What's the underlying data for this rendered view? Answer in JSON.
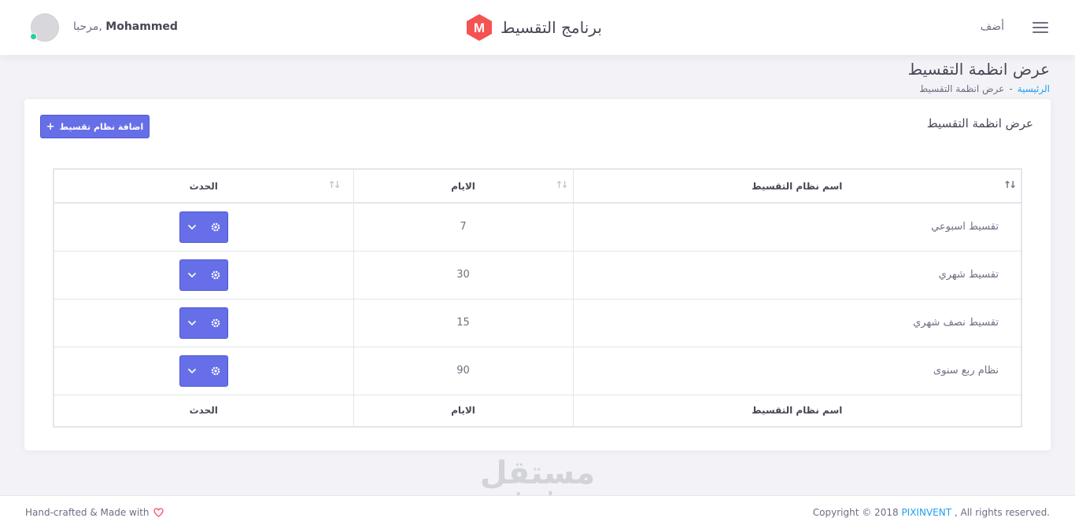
{
  "navbar": {
    "add_label": "أضف",
    "brand_letter": "M",
    "brand_name": "برنامج التقسيط",
    "greeting": "مرحبا,",
    "user_name": "Mohammed",
    "brand_color": "#f55252",
    "status_color": "#28d094"
  },
  "page": {
    "title": "عرض انظمة التقسيط",
    "breadcrumb_home": "الرئيسية",
    "breadcrumb_separator": "-",
    "breadcrumb_current": "عرض انظمة التقسيط"
  },
  "card": {
    "title": "عرض انظمة التقسيط",
    "add_button_label": "اضافة نظام تقسيط",
    "add_button_icon": "plus-icon",
    "accent_color": "#666ee8"
  },
  "table": {
    "headers": {
      "name": "اسم نظام التقسيط",
      "days": "الايام",
      "action": "الحدث"
    },
    "sort_icons": {
      "name": "↑↓",
      "days": "↑↓",
      "action": "↑↓"
    },
    "rows": [
      {
        "name": "تقسيط اسبوعي",
        "days": "7"
      },
      {
        "name": "تقسيط شهري",
        "days": "30"
      },
      {
        "name": "تقسيط نصف شهري",
        "days": "15"
      },
      {
        "name": "نظام ربع سنوى",
        "days": "90"
      }
    ],
    "row_action_icons": [
      "gear-icon",
      "chevron-down-icon"
    ],
    "footer": {
      "name": "اسم نظام التقسيط",
      "days": "الايام",
      "action": "الحدث"
    }
  },
  "watermark": {
    "arabic": "مستقل",
    "latin": "mostaql.com"
  },
  "footer": {
    "left_text": "Hand-crafted & Made with",
    "heart_icon": "heart-icon",
    "heart_color": "#ff4961",
    "right_prefix": "Copyright © 2018",
    "right_brand": "PIXINVENT",
    "right_suffix": ", All rights reserved."
  }
}
